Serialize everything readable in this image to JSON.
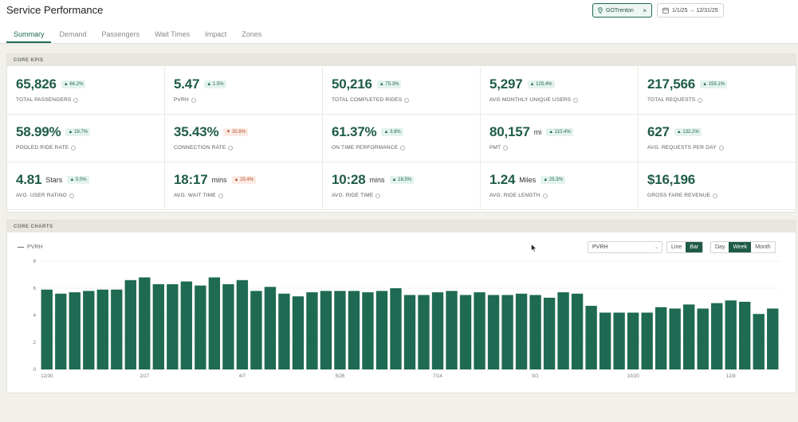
{
  "header": {
    "title": "Service Performance",
    "agency_filter": "GOTrenton",
    "agency_clear": "×",
    "date_range": "1/1/25 → 12/31/25"
  },
  "tabs": [
    {
      "label": "Summary"
    },
    {
      "label": "Demand"
    },
    {
      "label": "Passengers"
    },
    {
      "label": "Wait Times"
    },
    {
      "label": "Impact"
    },
    {
      "label": "Zones"
    }
  ],
  "kpi_section": {
    "title": "CORE KPIS",
    "items": [
      {
        "value": "65,826",
        "unit": "",
        "badge": "▲ 66.2%",
        "dir": "up",
        "label": "TOTAL PASSENGERS"
      },
      {
        "value": "5.47",
        "unit": "",
        "badge": "▲ 1.5%",
        "dir": "up",
        "label": "PVRH"
      },
      {
        "value": "50,216",
        "unit": "",
        "badge": "▲ 75.3%",
        "dir": "up",
        "label": "TOTAL COMPLETED RIDES"
      },
      {
        "value": "5,297",
        "unit": "",
        "badge": "▲ 125.4%",
        "dir": "up",
        "label": "AVG MONTHLY UNIQUE USERS"
      },
      {
        "value": "217,566",
        "unit": "",
        "badge": "▲ 159.1%",
        "dir": "up",
        "label": "TOTAL REQUESTS"
      },
      {
        "value": "58.99%",
        "unit": "",
        "badge": "▲ 19.7%",
        "dir": "up",
        "label": "POOLED RIDE RATE"
      },
      {
        "value": "35.43%",
        "unit": "",
        "badge": "▼ 30.8%",
        "dir": "down",
        "label": "CONNECTION RATE"
      },
      {
        "value": "61.37%",
        "unit": "",
        "badge": "▲ 3.8%",
        "dir": "up",
        "label": "ON TIME PERFORMANCE"
      },
      {
        "value": "80,157",
        "unit": "mi",
        "badge": "▲ 110.4%",
        "dir": "up",
        "label": "PMT"
      },
      {
        "value": "627",
        "unit": "",
        "badge": "▲ 132.2%",
        "dir": "up",
        "label": "AVG. REQUESTS PER DAY"
      },
      {
        "value": "4.81",
        "unit": "Stars",
        "badge": "▲ 0.0%",
        "dir": "up",
        "label": "AVG. USER RATING"
      },
      {
        "value": "18:17",
        "unit": "mins",
        "badge": "▲ 29.4%",
        "dir": "down",
        "label": "AVG. WAIT TIME"
      },
      {
        "value": "10:28",
        "unit": "mins",
        "badge": "▲ 18.5%",
        "dir": "up",
        "label": "AVG. RIDE TIME"
      },
      {
        "value": "1.24",
        "unit": "Miles",
        "badge": "▲ 25.3%",
        "dir": "up",
        "label": "AVG. RIDE LENGTH"
      },
      {
        "value": "$16,196",
        "unit": "",
        "badge": "",
        "dir": "up",
        "label": "GROSS FARE REVENUE"
      }
    ]
  },
  "chart_section": {
    "title": "CORE CHARTS",
    "metric_select": "PVRH",
    "chart_type_options": [
      "Line",
      "Bar"
    ],
    "chart_type_selected": "Bar",
    "granularity_options": [
      "Day",
      "Week",
      "Month"
    ],
    "granularity_selected": "Week",
    "bar_color": "#1f6a53"
  },
  "chart_data": {
    "type": "bar",
    "series": [
      {
        "name": "PVRH",
        "values": [
          5.9,
          5.6,
          5.7,
          5.8,
          5.9,
          5.9,
          6.6,
          6.8,
          6.3,
          6.3,
          6.5,
          6.2,
          6.8,
          6.3,
          6.6,
          5.8,
          6.1,
          5.6,
          5.4,
          5.7,
          5.8,
          5.8,
          5.8,
          5.7,
          5.8,
          6.0,
          5.5,
          5.5,
          5.7,
          5.8,
          5.5,
          5.7,
          5.5,
          5.5,
          5.6,
          5.5,
          5.3,
          5.7,
          5.6,
          4.7,
          4.2,
          4.2,
          4.2,
          4.2,
          4.6,
          4.5,
          4.8,
          4.5,
          4.9,
          5.1,
          5.0,
          4.1,
          4.5
        ]
      }
    ],
    "x_tick_labels": [
      "12/30",
      "2/17",
      "4/7",
      "5/26",
      "7/14",
      "9/1",
      "10/20",
      "12/8"
    ],
    "y_ticks": [
      0,
      2,
      4,
      6,
      8
    ],
    "ylim": [
      0,
      8
    ],
    "grid": true,
    "legend": "top-left"
  }
}
